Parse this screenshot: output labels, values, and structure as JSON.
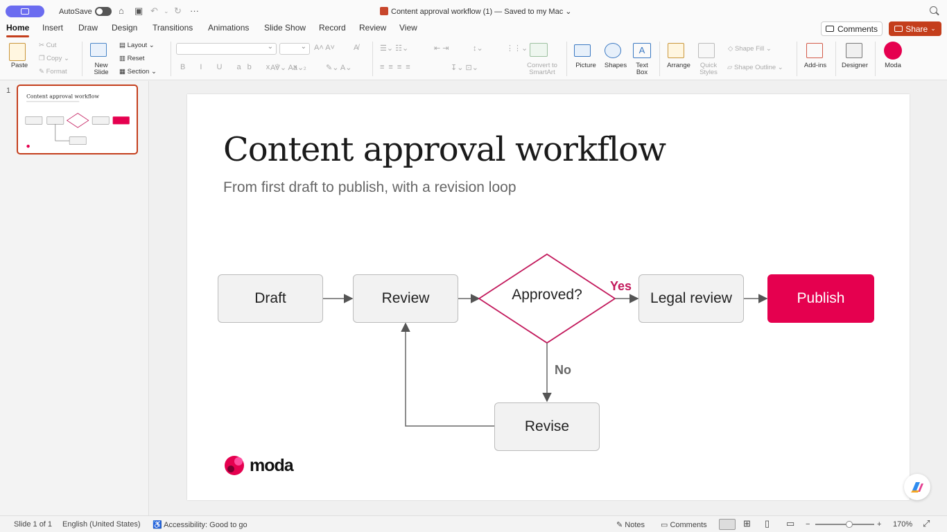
{
  "titlebar": {
    "autosave_label": "AutoSave",
    "doc_title": "Content approval workflow (1) — Saved to my Mac",
    "more": "···"
  },
  "tabs": [
    "Home",
    "Insert",
    "Draw",
    "Design",
    "Transitions",
    "Animations",
    "Slide Show",
    "Record",
    "Review",
    "View"
  ],
  "header_buttons": {
    "comments": "Comments",
    "share": "Share"
  },
  "ribbon": {
    "paste": "Paste",
    "cut": "Cut",
    "copy": "Copy",
    "format": "Format",
    "new_slide": "New\nSlide",
    "layout": "Layout",
    "reset": "Reset",
    "section": "Section",
    "convert": "Convert to\nSmartArt",
    "picture": "Picture",
    "shapes": "Shapes",
    "text_box": "Text\nBox",
    "arrange": "Arrange",
    "quick_styles": "Quick\nStyles",
    "shape_fill": "Shape Fill",
    "shape_outline": "Shape Outline",
    "add_ins": "Add-ins",
    "designer": "Designer",
    "moda": "Moda"
  },
  "thumbnail": {
    "number": "1"
  },
  "slide": {
    "title": "Content approval workflow",
    "subtitle": "From first draft to publish, with a revision loop",
    "nodes": {
      "draft": "Draft",
      "review": "Review",
      "approved": "Approved?",
      "legal": "Legal review",
      "publish": "Publish",
      "revise": "Revise"
    },
    "yes": "Yes",
    "no": "No",
    "logo": "moda"
  },
  "status": {
    "slide_count": "Slide 1 of 1",
    "language": "English (United States)",
    "accessibility": "Accessibility: Good to go",
    "notes": "Notes",
    "comments": "Comments",
    "zoom": "170%"
  },
  "colors": {
    "accent": "#c43e1c",
    "publish": "#e5004f",
    "yes_label": "#c2185b",
    "diamond": "#c2185b"
  }
}
